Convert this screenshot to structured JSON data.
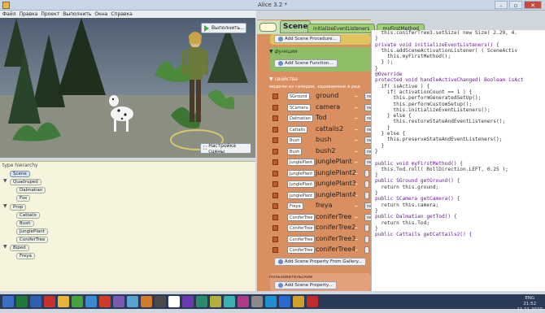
{
  "window": {
    "title": "Alice 3.2 *"
  },
  "menubar": {
    "items": [
      "Файл",
      "Правка",
      "Проект",
      "Выполнить",
      "Окна",
      "Справка"
    ]
  },
  "viewport": {
    "run_label": "Выполнить...",
    "setup_label": "Настройка сцены"
  },
  "tree": {
    "label": "type hierarchy",
    "nodes": {
      "scene": "Scene",
      "quadruped": "Quadruped",
      "dalmatian": "Dalmatian",
      "fox": "Fox",
      "prop": "Prop",
      "cattails": "Cattails",
      "bush": "Bush",
      "jungleplant": "JunglePlant",
      "conifertree": "ConiferTree",
      "biped": "Biped",
      "freya": "Freya"
    }
  },
  "tabs": {
    "scene": "Scene",
    "tab2": "initializeEventListeners",
    "tab3": "myFirstMethod"
  },
  "scene_panel": {
    "add_procedure": "Add Scene Procedure...",
    "functions_header": "функции",
    "add_function": "Add Scene Function...",
    "properties_header": "свойства",
    "properties_note": "модели из галереи, задаваемые в ред",
    "properties": [
      {
        "type": "SGround",
        "name": "ground",
        "new": "new"
      },
      {
        "type": "SCamera",
        "name": "camera",
        "new": "new"
      },
      {
        "type": "Dalmatian",
        "name": "Tod",
        "new": "new Da"
      },
      {
        "type": "Cattails",
        "name": "cattails2",
        "new": "new"
      },
      {
        "type": "Bush",
        "name": "bush",
        "new": "new Bush"
      },
      {
        "type": "Bush",
        "name": "bush2",
        "new": "new Bus"
      },
      {
        "type": "JunglePlant",
        "name": "junglePlant",
        "new": "new"
      },
      {
        "type": "JunglePlant",
        "name": "junglePlant2",
        "new": ""
      },
      {
        "type": "JunglePlant",
        "name": "junglePlant3",
        "new": ""
      },
      {
        "type": "JunglePlant",
        "name": "junglePlant4",
        "new": ""
      },
      {
        "type": "Freya",
        "name": "freya",
        "new": "new Freya"
      },
      {
        "type": "ConiferTree",
        "name": "coniferTree",
        "new": "ne"
      },
      {
        "type": "ConiferTree",
        "name": "coniferTree2",
        "new": ""
      },
      {
        "type": "ConiferTree",
        "name": "coniferTree3",
        "new": ""
      },
      {
        "type": "ConiferTree",
        "name": "coniferTree4",
        "new": ""
      }
    ],
    "add_property": "Add Scene Property From Gallery...",
    "user_header": "пользовательские",
    "add_user_property": "Add Scene Property..."
  },
  "code": {
    "lines": [
      "  this.coniferTree3.setSize( new Size( 2.29, 4.",
      "}",
      "private void initializeEventListeners() {",
      "  this.addSceneActivationListener( ( SceneActiv",
      "    this.myFirstMethod();",
      "  } );",
      "}",
      "@Override",
      "protected void handleActiveChanged( Boolean isAct",
      "  if( isActive ) {",
      "    if( activationCount == 1 ) {",
      "      this.performGeneratedSetUp();",
      "      this.performCustomSetup();",
      "      this.initializeEventListeners();",
      "    } else {",
      "      this.restoreStateAndEventListeners();",
      "    }",
      "  } else {",
      "    this.preserveStateAndEventListeners();",
      "  }",
      "}",
      "",
      "public void myFirstMethod() {",
      "  this.Tod.roll( RollDirection.LEFT, 0.25 );",
      "}",
      "public SGround getGround() {",
      "  return this.ground;",
      "}",
      "public SCamera getCamera() {",
      "  return this.camera;",
      "}",
      "public Dalmatian getTod() {",
      "  return this.Tod;",
      "}",
      "public Cattails getCattails2() {"
    ]
  },
  "taskbar": {
    "icons": [
      "windows-icon",
      "excel-icon",
      "word-icon",
      "red-app-icon",
      "folder-icon",
      "green-app-icon",
      "image-icon",
      "yandex-icon",
      "gear-icon",
      "app-icon",
      "app2-icon",
      "app3-icon",
      "alice-icon",
      "vs-icon",
      "app4-icon",
      "app5-icon",
      "app6-icon",
      "app7-icon",
      "app8-icon",
      "skype-icon",
      "s-icon",
      "app9-icon",
      "pdf-icon"
    ],
    "lang": "ENG",
    "time": "21:52",
    "date": "11.11.2020"
  }
}
